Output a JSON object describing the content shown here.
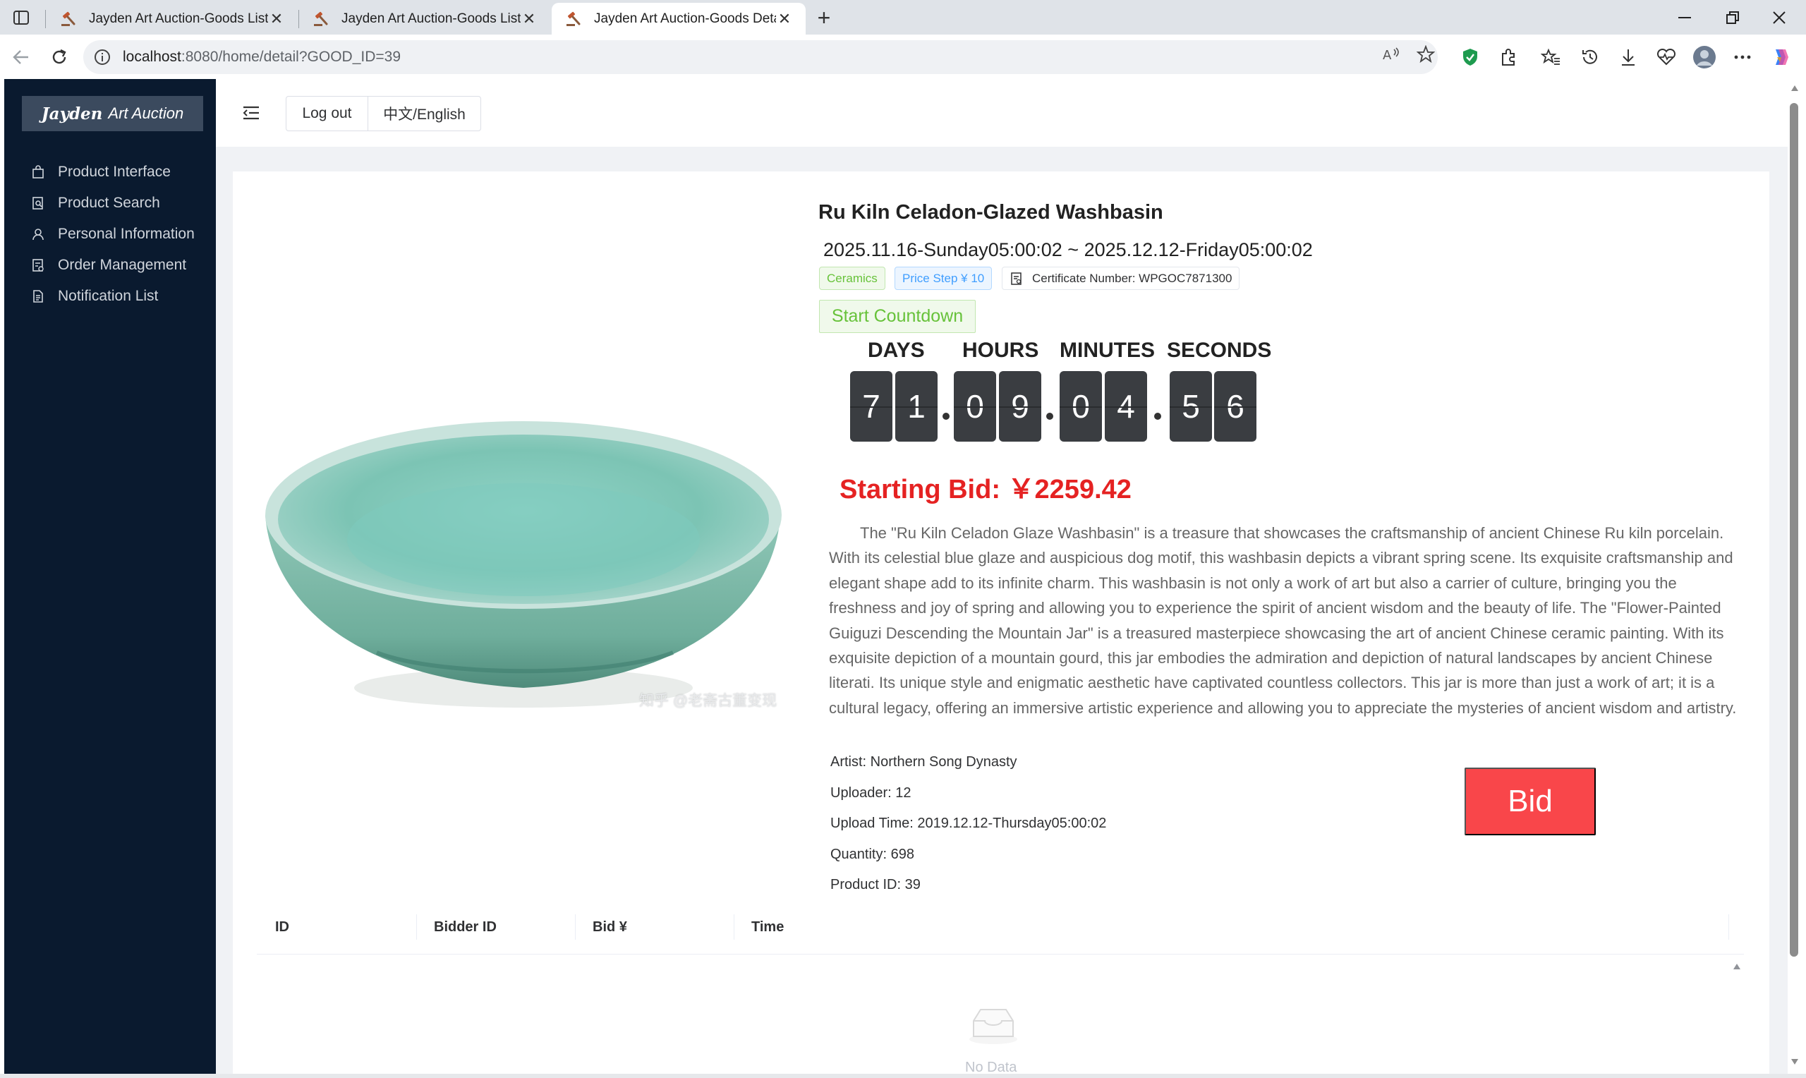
{
  "browser": {
    "tabs": [
      {
        "title": "Jayden Art Auction-Goods List",
        "active": false
      },
      {
        "title": "Jayden Art Auction-Goods List",
        "active": false
      },
      {
        "title": "Jayden Art Auction-Goods Detail",
        "active": true
      }
    ],
    "url_host": "localhost",
    "url_rest": ":8080/home/detail?GOOD_ID=39"
  },
  "sidebar": {
    "brand_bold": "Jayden",
    "brand_rest": "Art Auction",
    "items": [
      {
        "label": "Product Interface",
        "icon": "bag-icon"
      },
      {
        "label": "Product Search",
        "icon": "search-doc-icon"
      },
      {
        "label": "Personal Information",
        "icon": "user-icon"
      },
      {
        "label": "Order Management",
        "icon": "order-icon"
      },
      {
        "label": "Notification List",
        "icon": "document-icon"
      }
    ]
  },
  "header": {
    "logout_label": "Log out",
    "lang_label": "中文/English"
  },
  "product": {
    "title": "Ru Kiln Celadon-Glazed Washbasin",
    "date_range": "2025.11.16-Sunday05:00:02 ~ 2025.12.12-Friday05:00:02",
    "category_tag": "Ceramics",
    "price_step_tag": "Price Step ¥ 10",
    "certificate_tag": "Certificate Number: WPGOC7871300",
    "image_watermark": "知乎 @老斋古董变现",
    "countdown_button": "Start Countdown",
    "countdown_labels": {
      "days": "DAYS",
      "hours": "HOURS",
      "minutes": "MINUTES",
      "seconds": "SECONDS"
    },
    "countdown_digits": [
      "7",
      "1",
      "0",
      "9",
      "0",
      "4",
      "5",
      "6"
    ],
    "starting_bid": "Starting Bid: ￥2259.42",
    "description": "The \"Ru Kiln Celadon Glaze Washbasin\" is a treasure that showcases the craftsmanship of ancient Chinese Ru kiln porcelain. With its celestial blue glaze and auspicious dog motif, this washbasin depicts a vibrant spring scene. Its exquisite craftsmanship and elegant shape add to its infinite charm. This washbasin is not only a work of art but also a carrier of culture, bringing you the freshness and joy of spring and allowing you to experience the spirit of ancient wisdom and the beauty of life. The \"Flower-Painted Guiguzi Descending the Mountain Jar\" is a treasured masterpiece showcasing the art of ancient Chinese ceramic painting. With its exquisite depiction of a mountain gourd, this jar embodies the admiration and depiction of natural landscapes by ancient Chinese literati. Its unique style and enigmatic aesthetic have captivated countless collectors. This jar is more than just a work of art; it is a cultural legacy, offering an immersive artistic experience and allowing you to appreciate the mysteries of ancient wisdom and artistry.",
    "artist": "Artist: Northern Song Dynasty",
    "uploader": "Uploader: 12",
    "upload_time": "Upload Time: 2019.12.12-Thursday05:00:02",
    "quantity": "Quantity: 698",
    "product_id": "Product ID: 39",
    "bid_button": "Bid"
  },
  "bids_table": {
    "columns": [
      "ID",
      "Bidder ID",
      "Bid ¥",
      "Time"
    ],
    "rows": [],
    "empty_text": "No Data"
  },
  "colors": {
    "sidebar_bg": "#0a1a2f",
    "accent_red": "#f9464a",
    "price_red": "#e52222",
    "success_green": "#67c23a",
    "primary_blue": "#409eff"
  }
}
